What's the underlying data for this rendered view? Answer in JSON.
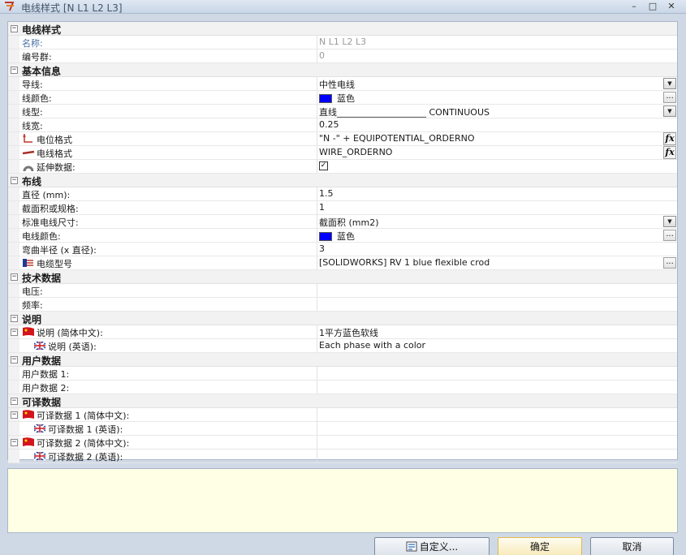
{
  "window": {
    "title": "电线样式 [N L1 L2 L3]",
    "minimize": "–",
    "maximize": "□",
    "close": "✕"
  },
  "grid": {
    "cat_style": "电线样式",
    "name_label": "名称:",
    "name_value": "N L1 L2 L3",
    "group_label": "编号群:",
    "group_value": "0",
    "cat_basic": "基本信息",
    "conductor_label": "导线:",
    "conductor_value": "中性电线",
    "line_color_label": "线颜色:",
    "line_color_value": "蓝色",
    "linetype_label": "线型:",
    "linetype_value": "直线____________________ CONTINUOUS",
    "linewidth_label": "线宽:",
    "linewidth_value": "0.25",
    "potential_format_label": "电位格式",
    "potential_format_value": "\"N -\" + EQUIPOTENTIAL_ORDERNO",
    "wire_format_label": "电线格式",
    "wire_format_value": "WIRE_ORDERNO",
    "extend_label": "延伸数据:",
    "extend_check": "✓",
    "cat_routing": "布线",
    "diameter_label": "直径 (mm):",
    "diameter_value": "1.5",
    "section_label": "截面积或规格:",
    "section_value": "1",
    "std_size_label": "标准电线尺寸:",
    "std_size_value": "截面积 (mm2)",
    "wire_color_label": "电线颜色:",
    "wire_color_value": "蓝色",
    "bend_label": "弯曲半径 (x 直径):",
    "bend_value": "3",
    "cable_ref_label": "电缆型号",
    "cable_ref_value": "[SOLIDWORKS] RV 1 blue flexible crod",
    "cat_tech": "技术数据",
    "voltage_label": "电压:",
    "freq_label": "频率:",
    "cat_desc": "说明",
    "desc_cn_label": "说明 (简体中文):",
    "desc_cn_value": "1平方蓝色软线",
    "desc_en_label": "说明 (英语):",
    "desc_en_value": "Each phase with a color",
    "cat_user": "用户数据",
    "user1_label": "用户数据 1:",
    "user2_label": "用户数据 2:",
    "cat_trans": "可译数据",
    "trans1_cn_label": "可译数据 1 (简体中文):",
    "trans1_en_label": "可译数据 1 (英语):",
    "trans2_cn_label": "可译数据 2 (简体中文):",
    "trans2_en_label": "可译数据 2 (英语):",
    "toggle_symbol": "−",
    "fx_label": "fx",
    "dots_label": "...",
    "dropdown_symbol": "▼"
  },
  "buttons": {
    "custom": "自定义...",
    "ok": "确定",
    "cancel": "取消"
  },
  "colors": {
    "swatch_blue": "#0000ff",
    "description_bg": "#ffffe6"
  },
  "icons": [
    "app-icon",
    "potential-icon",
    "wire-icon",
    "extend-icon",
    "cable-icon",
    "china-flag-icon",
    "uk-flag-icon",
    "customize-icon"
  ]
}
